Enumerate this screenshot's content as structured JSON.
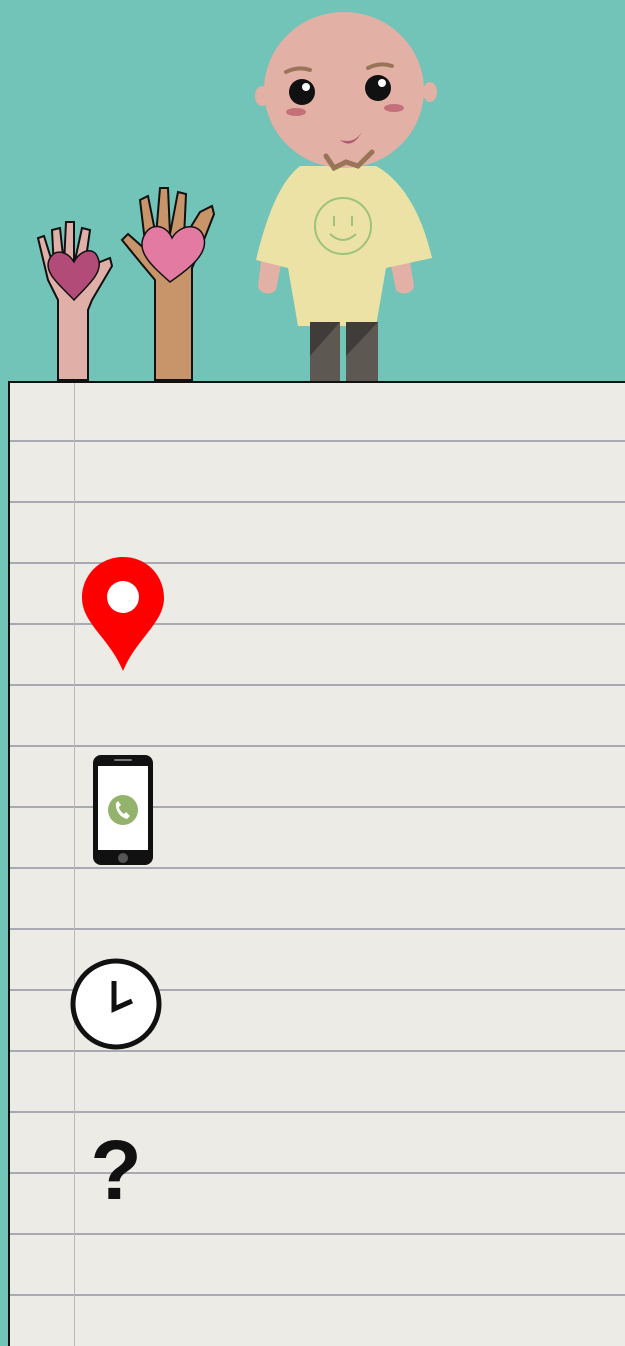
{
  "icons": {
    "location": "map-pin-icon",
    "phone": "smartphone-phone-icon",
    "hours": "clock-icon",
    "faq": "question-mark-icon"
  },
  "faq_glyph": "?",
  "colors": {
    "background": "#72c3b8",
    "paper": "#ecebe6",
    "pin": "#ff0000",
    "phone_badge": "#93b26b",
    "shirt": "#ece2a5",
    "skin": "#e2b0a5"
  }
}
